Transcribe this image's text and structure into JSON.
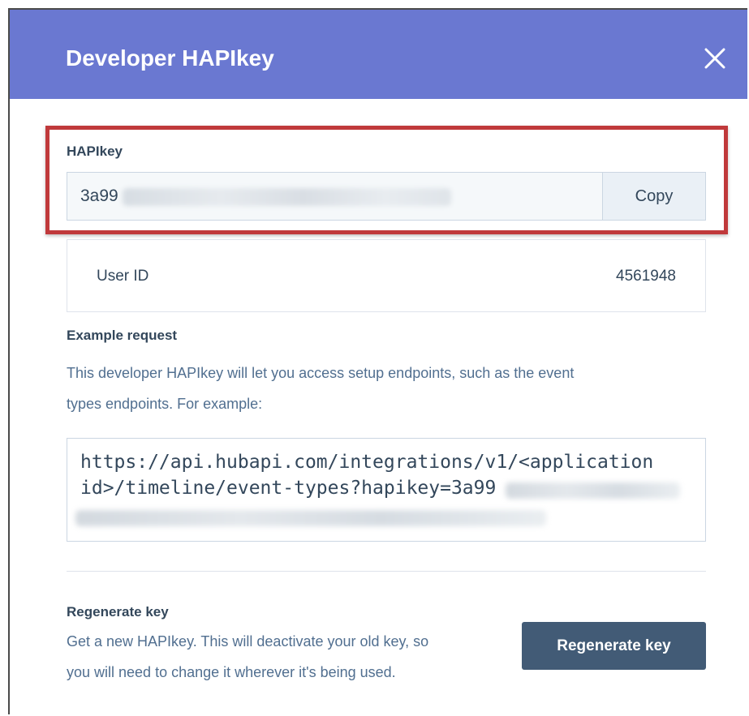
{
  "modal": {
    "title": "Developer HAPIkey",
    "close_icon": "close-icon"
  },
  "hapikey": {
    "label": "HAPIkey",
    "value_visible": "3a99",
    "copy_label": "Copy"
  },
  "user": {
    "label": "User ID",
    "value": "4561948"
  },
  "example": {
    "heading": "Example request",
    "description_line1": "This developer HAPIkey will let you access setup endpoints, such as the event",
    "description_line2": "types endpoints. For example:",
    "code_line1": "https://api.hubapi.com/integrations/v1/<application",
    "code_line2": "id>/timeline/event-types?hapikey=3a99"
  },
  "regenerate": {
    "heading": "Regenerate key",
    "description_line1": "Get a new HAPIkey. This will deactivate your old key, so",
    "description_line2": "you will need to change it wherever it's being used.",
    "button_label": "Regenerate key"
  },
  "colors": {
    "header_bg": "#6a78d1",
    "highlight": "#c0393b",
    "primary_button": "#425b76",
    "text": "#33475b"
  }
}
